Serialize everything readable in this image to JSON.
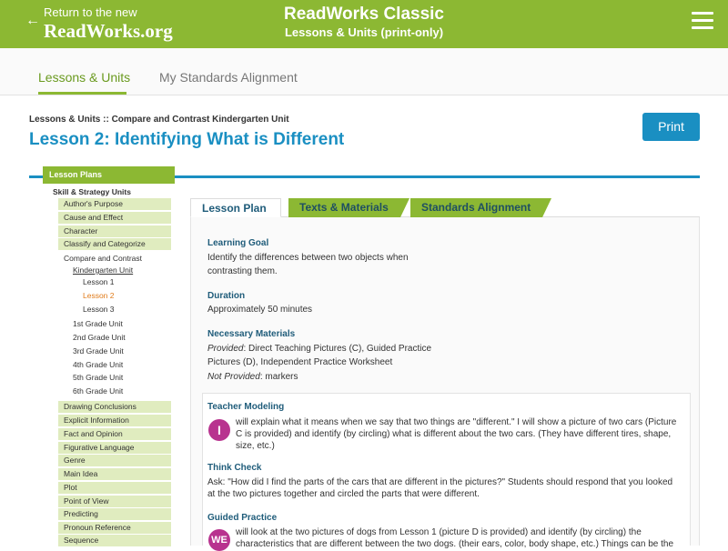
{
  "header": {
    "back_text": "Return to the new",
    "back_logo": "ReadWorks.org",
    "back_arrow": "←",
    "title": "ReadWorks Classic",
    "subtitle": "Lessons & Units (print-only)",
    "menu_icon": "hamburger-menu-icon"
  },
  "nav": {
    "tabs": [
      {
        "label": "Lessons & Units",
        "active": true
      },
      {
        "label": "My Standards Alignment",
        "active": false
      }
    ]
  },
  "breadcrumb": "Lessons & Units :: Compare and Contrast Kindergarten Unit",
  "page_title": "Lesson 2: Identifying What is Different",
  "print_label": "Print",
  "sidebar": {
    "header": "Lesson Plans",
    "section": "Skill & Strategy Units",
    "items_top": [
      "Author's Purpose",
      "Cause and Effect",
      "Character",
      "Classify and Categorize"
    ],
    "current_unit": "Compare and Contrast",
    "current_sub": "Kindergarten Unit",
    "lessons": [
      "Lesson 1",
      "Lesson 2",
      "Lesson 3"
    ],
    "grade_units": [
      "1st Grade Unit",
      "2nd Grade Unit",
      "3rd Grade Unit",
      "4th Grade Unit",
      "5th Grade Unit",
      "6th Grade Unit"
    ],
    "items_bottom": [
      "Drawing Conclusions",
      "Explicit Information",
      "Fact and Opinion",
      "Figurative Language",
      "Genre",
      "Main Idea",
      "Plot",
      "Point of View",
      "Predicting",
      "Pronoun Reference",
      "Sequence"
    ]
  },
  "content_tabs": [
    "Lesson Plan",
    "Texts & Materials",
    "Standards Alignment"
  ],
  "lesson": {
    "goal_heading": "Learning Goal",
    "goal_line1": "Identify the differences between two objects when",
    "goal_line2": "contrasting them.",
    "duration_heading": "Duration",
    "duration_text": "Approximately 50 minutes",
    "materials_heading": "Necessary Materials",
    "provided_label": "Provided",
    "provided_line1": ": Direct Teaching Pictures (C), Guided Practice",
    "provided_line2": "Pictures (D), Independent Practice Worksheet",
    "not_provided_label": "Not Provided",
    "not_provided_text": ": markers"
  },
  "teaching": {
    "modeling_heading": "Teacher Modeling",
    "modeling_badge": "I",
    "modeling_line1": "will explain what it means when we say that two things are \"different.\" I will show a picture of two cars (Picture",
    "modeling_line2": "C is provided) and identify (by circling) what is different about the two cars. (They have different tires, shape,",
    "modeling_line3": "size, etc.)",
    "think_heading": "Think Check",
    "think_line1": "Ask: \"How did I find the parts of the cars that are different in the pictures?\" Students should respond that you looked",
    "think_line2": "at the two pictures together and circled the parts that were different.",
    "guided_heading": "Guided Practice",
    "guided_badge": "WE",
    "guided_line1": "will look at the two pictures of dogs from Lesson 1 (picture D is provided) and identify (by circling) the",
    "guided_line2": "characteristics that are different between the two dogs. (their ears, color, body shape, etc.) Things can be the"
  },
  "colors": {
    "brand_green": "#8cb833",
    "brand_blue": "#1a8fc2",
    "badge_magenta": "#b8338f",
    "sidebar_item_bg": "#e0ecbf",
    "current_lesson": "#e07b1a"
  }
}
